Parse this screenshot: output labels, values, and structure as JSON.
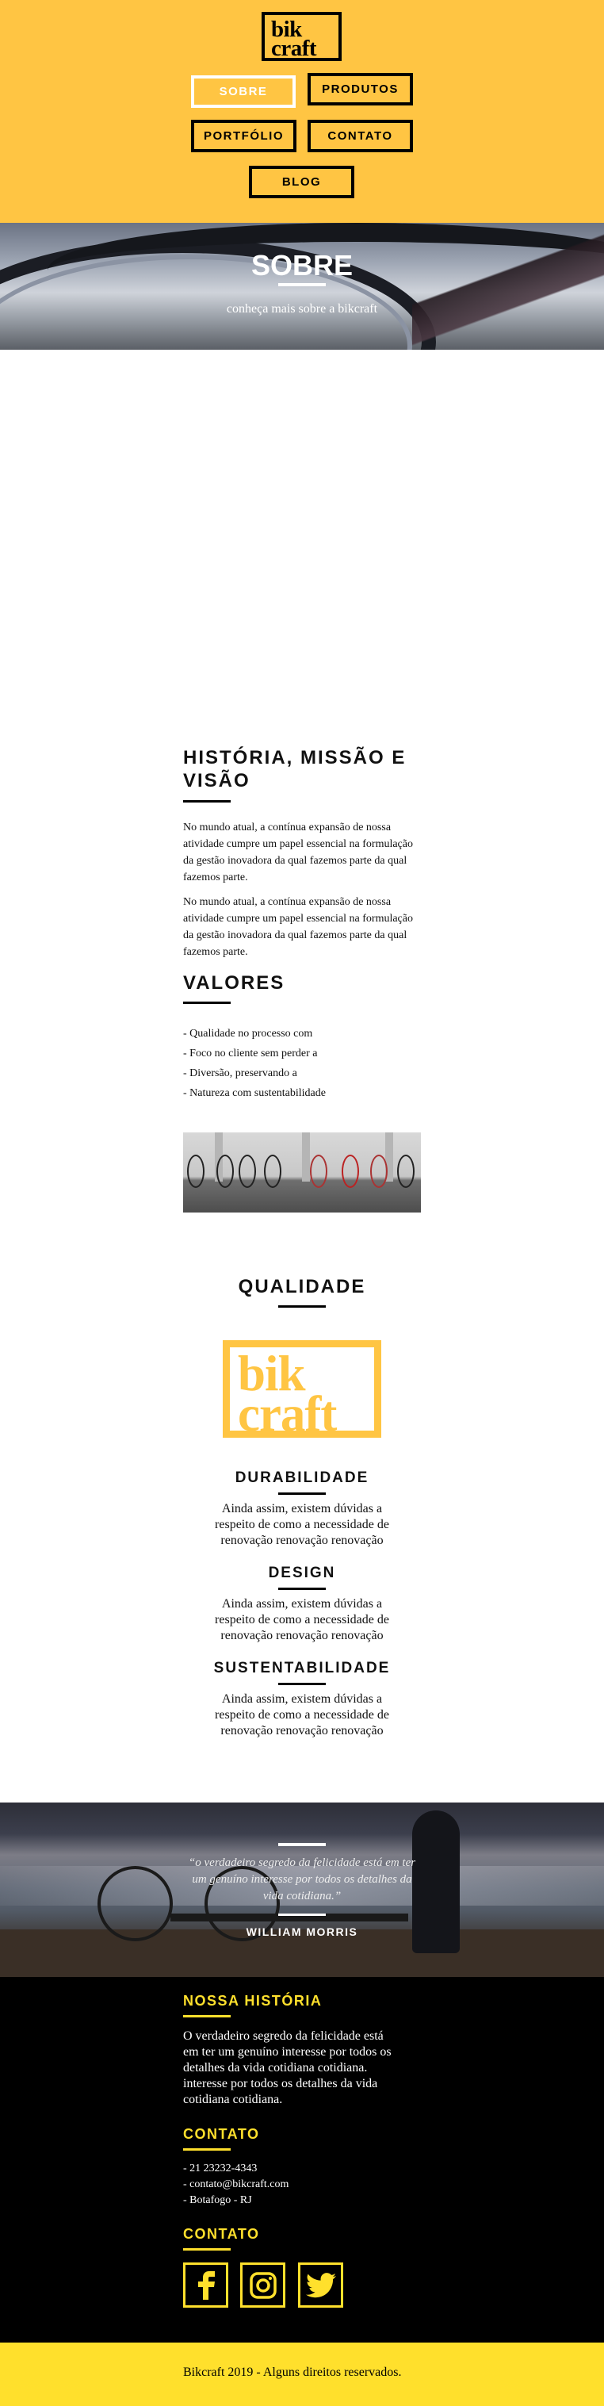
{
  "header": {
    "logo_line1": "bik",
    "logo_line2": "craft",
    "nav": [
      "SOBRE",
      "PRODUTOS",
      "PORTFÓLIO",
      "CONTATO",
      "BLOG"
    ]
  },
  "hero": {
    "title": "SOBRE",
    "subtitle": "conheça mais sobre a bikcraft"
  },
  "history": {
    "title": "HISTÓRIA, MISSÃO E VISÃO",
    "paragraphs": [
      "No mundo atual, a contínua expansão de nossa atividade cumpre um papel essencial na formulação da gestão inovadora da qual fazemos parte da qual fazemos parte.",
      "No mundo atual, a contínua expansão de nossa atividade cumpre um papel essencial na formulação da gestão inovadora da qual fazemos parte da qual fazemos parte."
    ]
  },
  "values": {
    "title": "VALORES",
    "items": [
      "- Qualidade no processo com",
      "- Foco no cliente sem perder a",
      "- Diversão, preservando a",
      "- Natureza com sustentabilidade"
    ]
  },
  "quality": {
    "title": "QUALIDADE",
    "logo_line1": "bik",
    "logo_line2": "craft",
    "features": [
      {
        "title": "DURABILIDADE",
        "text": "Ainda assim, existem dúvidas a respeito de como a necessidade de renovação renovação renovação"
      },
      {
        "title": "DESIGN",
        "text": "Ainda assim, existem dúvidas a respeito de como a necessidade de renovação renovação renovação"
      },
      {
        "title": "SUSTENTABILIDADE",
        "text": "Ainda assim, existem dúvidas a respeito de como a necessidade de renovação renovação renovação"
      }
    ]
  },
  "quote": {
    "text": "“o verdadeiro segredo da felicidade está em ter um genuíno interesse por todos os detalhes da vida cotidiana.”",
    "author": "WILLIAM MORRIS"
  },
  "footer": {
    "history_title": "NOSSA HISTÓRIA",
    "history_text": "O verdadeiro segredo da felicidade está em ter um genuíno interesse por todos os detalhes da vida cotidiana cotidiana. interesse por todos os detalhes da vida cotidiana cotidiana.",
    "contact_title": "CONTATO",
    "contact_lines": [
      "- 21 23232-4343",
      "- contato@bikcraft.com",
      "- Botafogo - RJ"
    ],
    "social_title": "CONTATO",
    "social_icons": [
      "facebook-icon",
      "instagram-icon",
      "twitter-icon"
    ],
    "copyright": "Bikcraft 2019 - Alguns direitos reservados."
  },
  "colors": {
    "header_yellow": "#FFC543",
    "footer_yellow": "#FFE02C",
    "black": "#000000"
  }
}
